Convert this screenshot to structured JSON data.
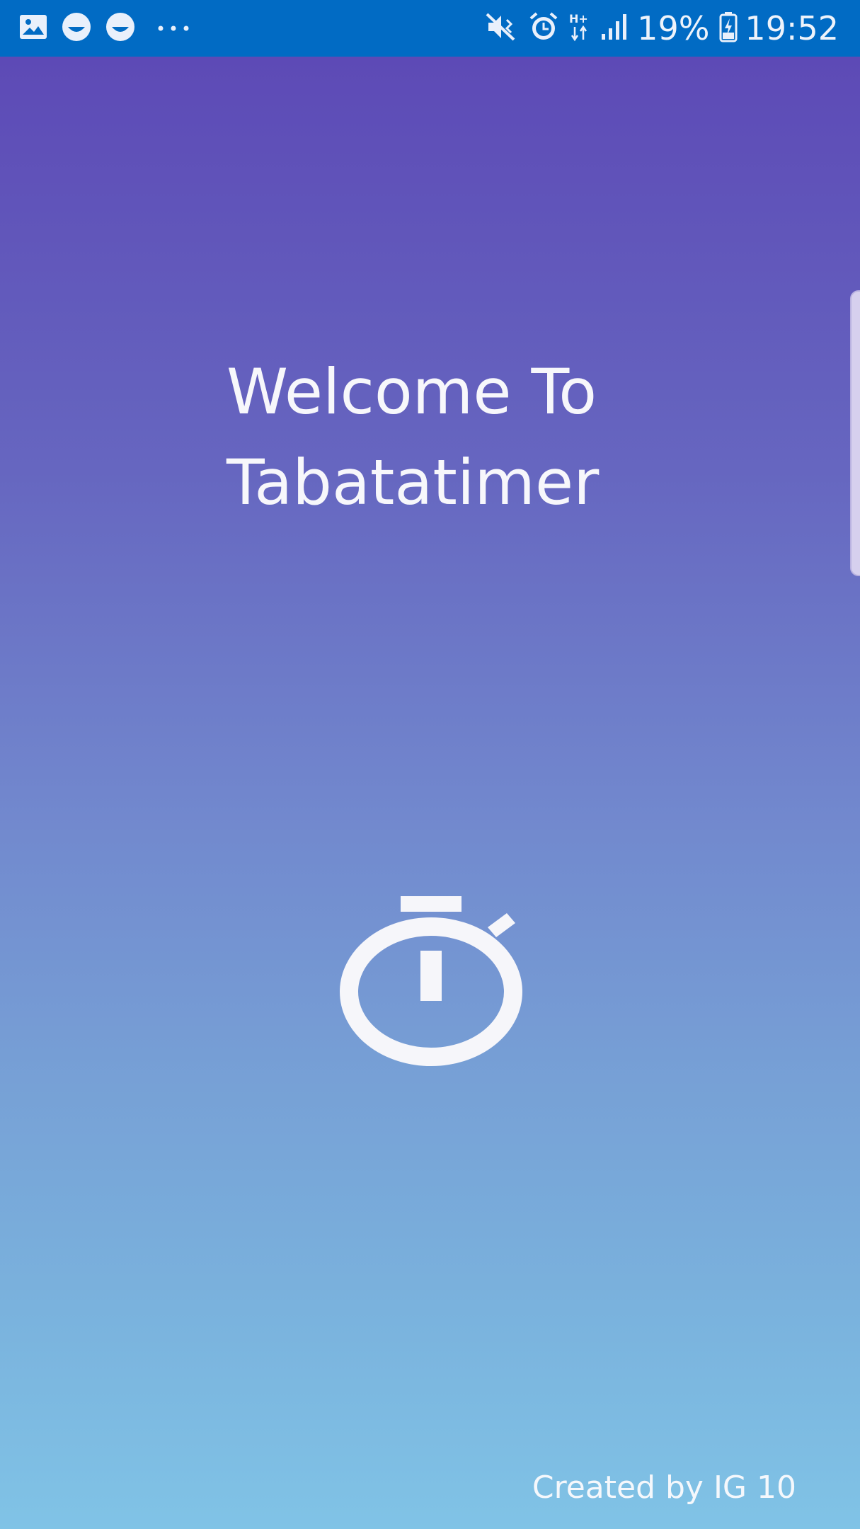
{
  "status_bar": {
    "background": "#016bc4",
    "left_icons": [
      "gallery-icon",
      "smile-icon",
      "smile-icon",
      "more-dots-icon"
    ],
    "right_icons": [
      "mute-vibrate-icon",
      "alarm-icon",
      "hplus-data-icon",
      "signal-icon",
      "battery-charging-icon"
    ],
    "battery_percent": "19%",
    "time": "19:52"
  },
  "welcome": {
    "line1": "Welcome To",
    "line2": "Tabatatimer"
  },
  "center_icon": "stopwatch-icon",
  "footer": {
    "credit": "Created by IG 10"
  },
  "colors": {
    "gradient_top": "#5d4ab6",
    "gradient_bottom": "#80c3e6",
    "text": "#f7f7fb"
  }
}
